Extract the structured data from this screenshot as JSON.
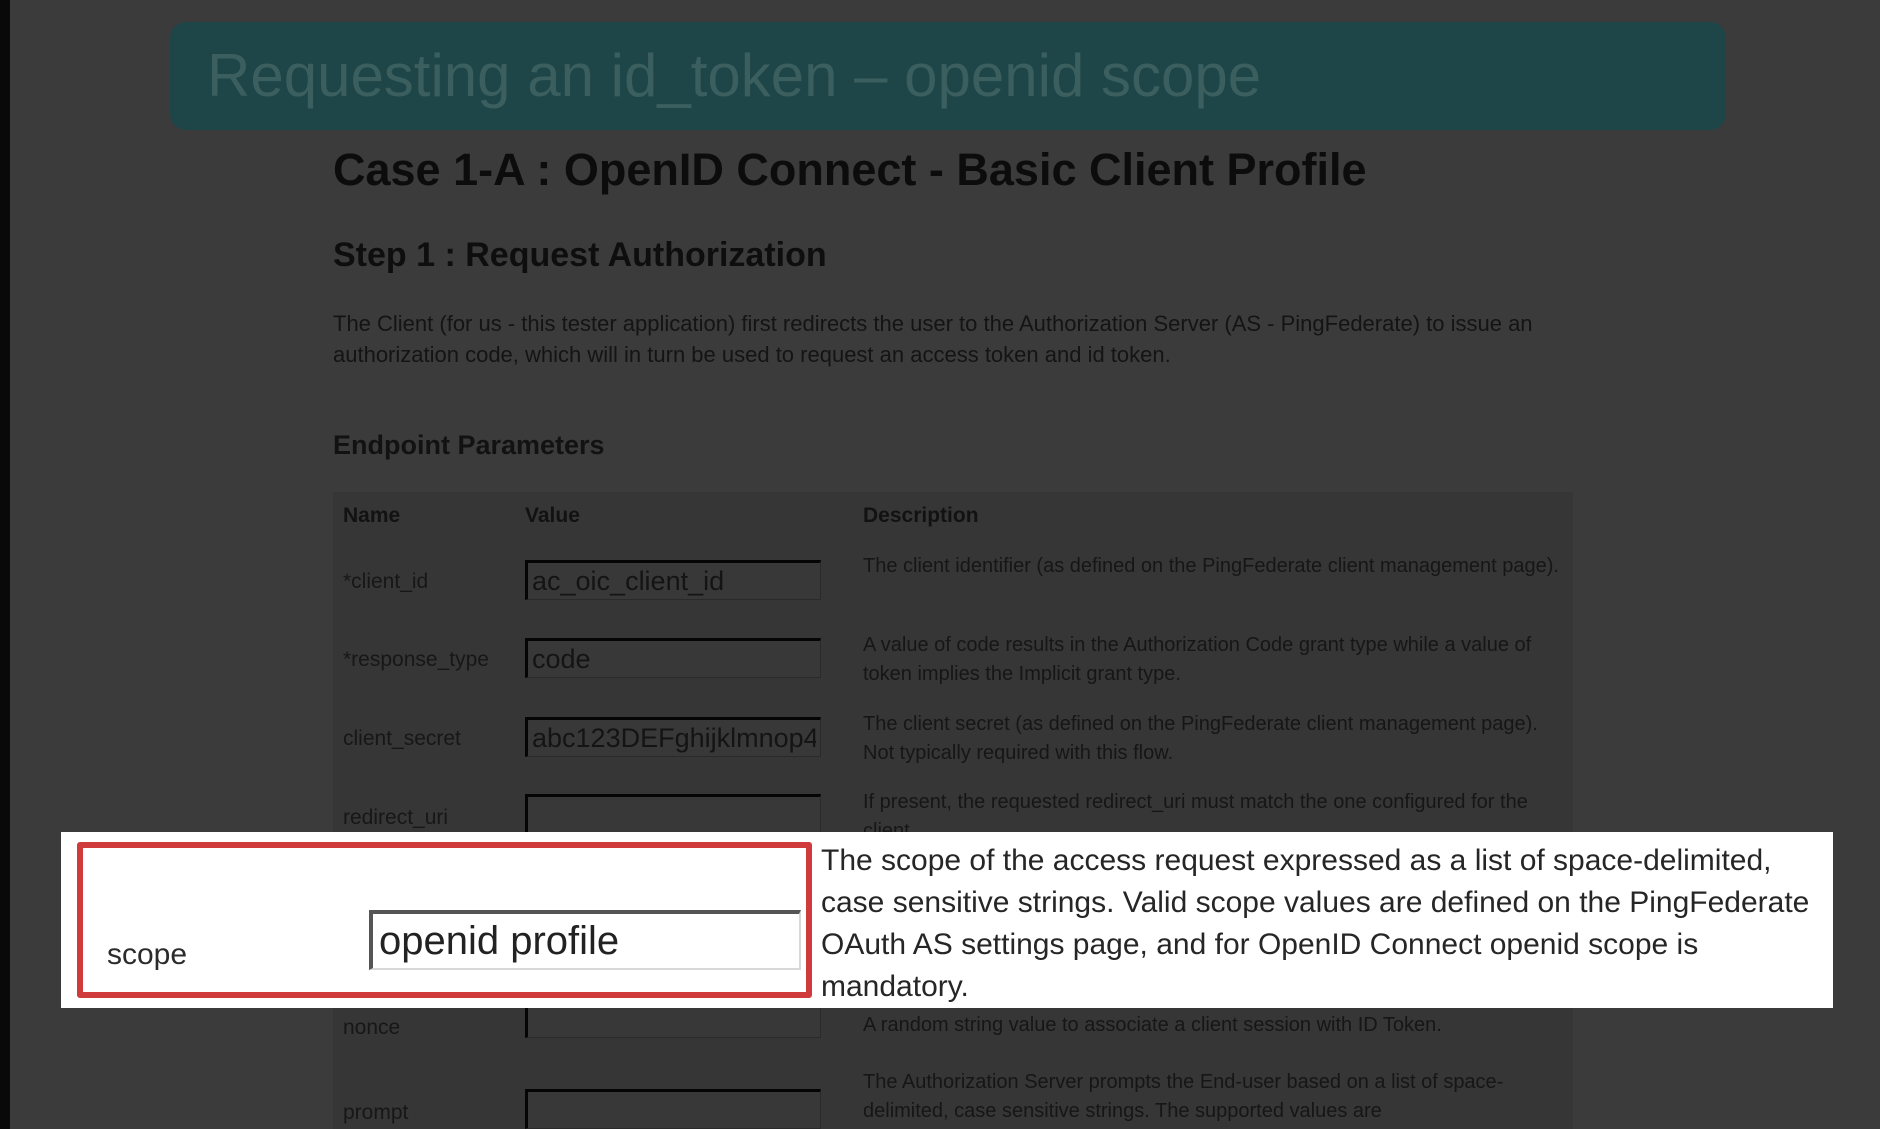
{
  "slide": {
    "title": "Requesting an id_token – openid scope"
  },
  "page": {
    "heading": "Case 1-A : OpenID Connect - Basic Client Profile",
    "step_heading": "Step 1 : Request Authorization",
    "step_description": "The Client (for us - this tester application) first redirects the user to the Authorization Server (AS - PingFederate) to issue an authorization code, which will in turn be used to request an access token and id token.",
    "params_heading": "Endpoint Parameters"
  },
  "table": {
    "columns": [
      "Name",
      "Value",
      "Description"
    ],
    "rows": [
      {
        "name": "*client_id",
        "value": "ac_oic_client_id",
        "description": "The client identifier (as defined on the PingFederate client management page)."
      },
      {
        "name": "*response_type",
        "value": "code",
        "description": "A value of code results in the Authorization Code grant type while a value of token implies the Implicit grant type."
      },
      {
        "name": "client_secret",
        "value": "abc123DEFghijklmnop4",
        "description": "The client secret (as defined on the PingFederate client management page). Not typically required with this flow."
      },
      {
        "name": "redirect_uri",
        "value": "",
        "description": "If present, the requested redirect_uri must match the one configured for the client."
      },
      {
        "name": "nonce",
        "value": "",
        "description": "A random string value to associate a client session with ID Token."
      },
      {
        "name": "prompt",
        "value": "",
        "description": "The Authorization Server prompts the End-user based on a list of space-delimited, case sensitive strings. The supported values are"
      }
    ]
  },
  "callout": {
    "label": "scope",
    "value": "openid profile",
    "description": "The scope of the access request expressed as a list of space-delimited, case sensitive strings. Valid scope values are defined on the PingFederate OAuth AS settings page, and for OpenID Connect openid scope is mandatory.",
    "highlight_color": "#cf3a3a"
  }
}
